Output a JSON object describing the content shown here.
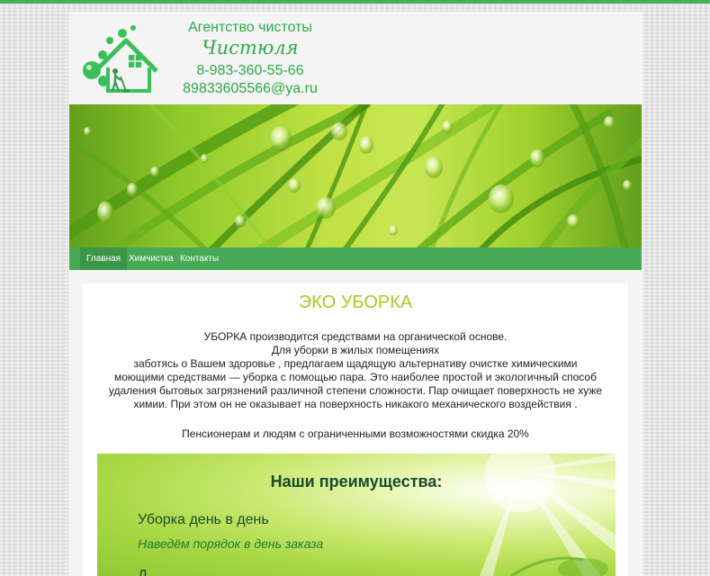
{
  "header": {
    "agency": "Агентство чистоты",
    "brand": "Чистюля",
    "phone": "8-983-360-55-66",
    "email": "89833605566@ya.ru"
  },
  "nav": {
    "items": [
      "Главная",
      "Химчистка",
      "Контакты"
    ],
    "active": "Главная"
  },
  "content": {
    "title": "ЭКО УБОРКА",
    "line1": "УБОРКА производится средствами на органической основе.",
    "line2": "Для уборки в жилых помещениях",
    "line3": "заботясь о Вашем здоровье , предлагаем щадящую альтернативу очистке химическими",
    "line4": "моющими средствами — уборка с помощью пара. Это наиболее простой и экологичный способ",
    "line5": "удаления бытовых загрязнений различной степени сложности. Пар очищает поверхность не хуже",
    "line6": "химии. При этом он не оказывает на поверхность никакого механического воздействия .",
    "discount": "Пенсионерам и людям с ограниченными возможностями скидка 20%"
  },
  "advantages": {
    "title": "Наши преимущества:",
    "item1": "Уборка день в день",
    "item1_sub": "Наведём порядок в день заказа",
    "item2": "Д"
  },
  "colors": {
    "brand_green": "#2eaa4a",
    "nav_green": "#48a957",
    "title_lime": "#a6cb22"
  }
}
